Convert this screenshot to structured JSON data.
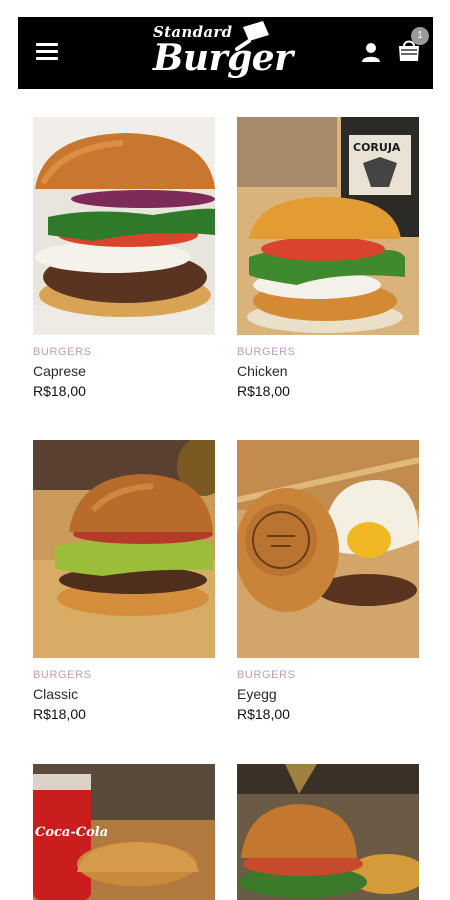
{
  "header": {
    "logo_top": "Standard",
    "logo_main": "Burger",
    "cart_count": "1"
  },
  "colors": {
    "header_bg": "#000000",
    "category": "#c29ab8",
    "badge": "#9a9a9a"
  },
  "icons": [
    "menu-icon",
    "cleaver-icon",
    "user-icon",
    "shopping-bag-icon"
  ],
  "products": [
    {
      "category": "BURGERS",
      "name": "Caprese",
      "price": "R$18,00"
    },
    {
      "category": "BURGERS",
      "name": "Chicken",
      "price": "R$18,00"
    },
    {
      "category": "BURGERS",
      "name": "Classic",
      "price": "R$18,00"
    },
    {
      "category": "BURGERS",
      "name": "Eyegg",
      "price": "R$18,00"
    },
    {
      "category": "",
      "name": "",
      "price": ""
    },
    {
      "category": "",
      "name": "",
      "price": ""
    }
  ],
  "images": {
    "beer_label": "CORUJA",
    "can_label": "Coca-Cola"
  }
}
